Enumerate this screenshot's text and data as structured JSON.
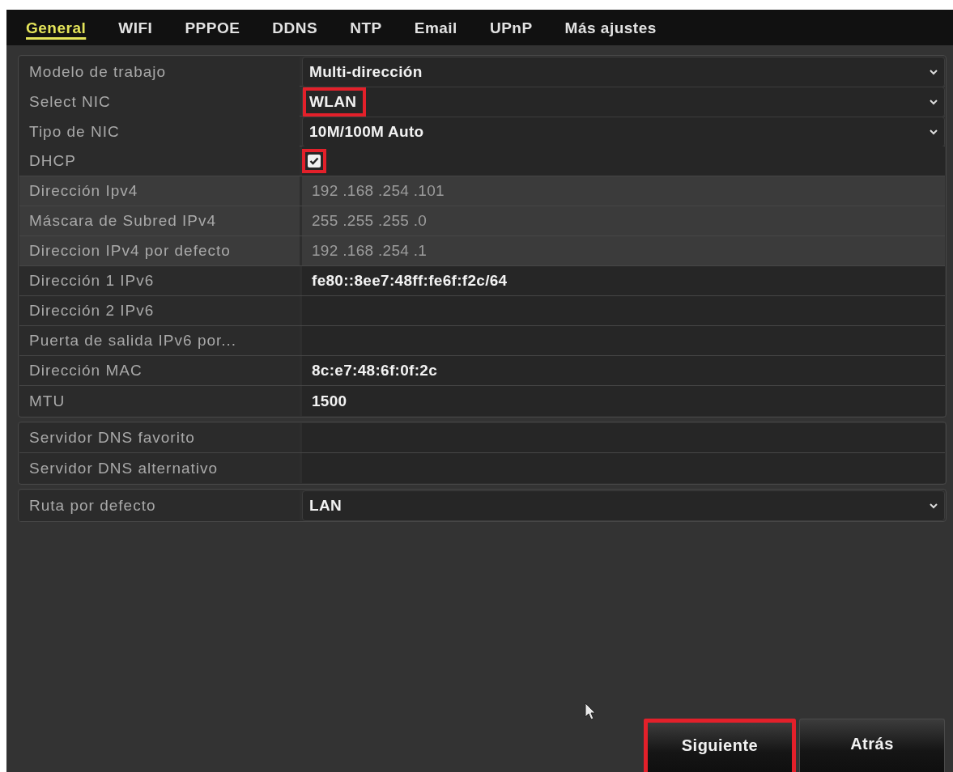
{
  "tabs": [
    {
      "label": "General",
      "selected": true
    },
    {
      "label": "WIFI",
      "selected": false
    },
    {
      "label": "PPPOE",
      "selected": false
    },
    {
      "label": "DDNS",
      "selected": false
    },
    {
      "label": "NTP",
      "selected": false
    },
    {
      "label": "Email",
      "selected": false
    },
    {
      "label": "UPnP",
      "selected": false
    },
    {
      "label": "Más ajustes",
      "selected": false
    }
  ],
  "groups": [
    {
      "rows": [
        {
          "label": "Modelo de trabajo",
          "kind": "select",
          "value": "Multi-dirección",
          "disabled": false,
          "highlighted": false
        },
        {
          "label": "Select NIC",
          "kind": "select",
          "value": "WLAN",
          "disabled": false,
          "highlighted": true
        },
        {
          "label": "Tipo de NIC",
          "kind": "select",
          "value": "10M/100M Auto",
          "disabled": false,
          "highlighted": false
        },
        {
          "label": "DHCP",
          "kind": "checkbox",
          "checked": true,
          "disabled": false,
          "highlighted": true
        },
        {
          "label": "Dirección Ipv4",
          "kind": "field",
          "value": "192 .168 .254 .101",
          "disabled": true,
          "highlighted": false
        },
        {
          "label": "Máscara de Subred IPv4",
          "kind": "field",
          "value": "255 .255 .255 .0",
          "disabled": true,
          "highlighted": false
        },
        {
          "label": "Direccion IPv4 por defecto",
          "kind": "field",
          "value": "192 .168 .254 .1",
          "disabled": true,
          "highlighted": false
        },
        {
          "label": "Dirección 1 IPv6",
          "kind": "field",
          "value": "fe80::8ee7:48ff:fe6f:f2c/64",
          "disabled": false,
          "highlighted": false
        },
        {
          "label": "Dirección 2 IPv6",
          "kind": "field",
          "disabled": false,
          "highlighted": false
        },
        {
          "label": "Puerta de salida IPv6 por...",
          "kind": "field",
          "disabled": false,
          "highlighted": false
        },
        {
          "label": "Dirección MAC",
          "kind": "field",
          "value": "8c:e7:48:6f:0f:2c",
          "disabled": false,
          "highlighted": false
        },
        {
          "label": "MTU",
          "kind": "field",
          "value": "1500",
          "disabled": false,
          "highlighted": false
        }
      ]
    },
    {
      "rows": [
        {
          "label": "Servidor DNS favorito",
          "kind": "field",
          "disabled": false,
          "highlighted": false
        },
        {
          "label": "Servidor DNS alternativo",
          "kind": "field",
          "disabled": false,
          "highlighted": false
        }
      ]
    },
    {
      "rows": [
        {
          "label": "Ruta por defecto",
          "kind": "select",
          "value": "LAN",
          "disabled": false,
          "highlighted": false
        }
      ]
    }
  ],
  "buttons": [
    {
      "label": "Siguiente",
      "highlighted": true
    },
    {
      "label": "Atrás",
      "highlighted": false
    }
  ]
}
